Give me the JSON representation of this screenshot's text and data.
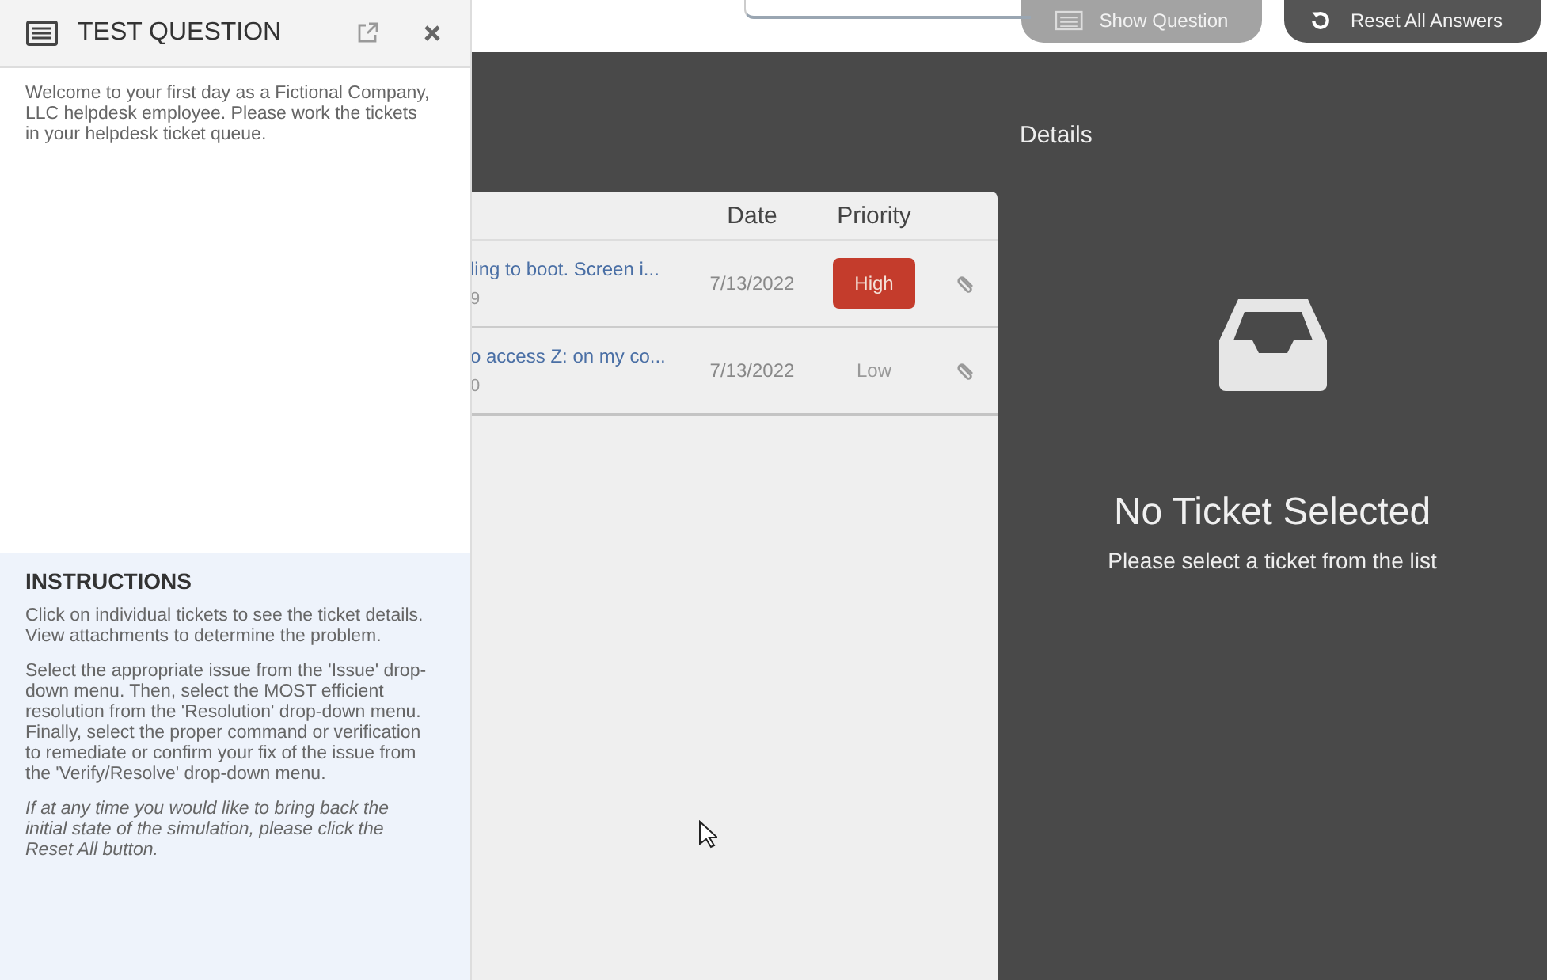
{
  "top_bar": {
    "buttons": [
      {
        "label": "Show Question",
        "kind": "secondary"
      },
      {
        "label": "Reset All Answers",
        "kind": "primary"
      }
    ]
  },
  "question_panel": {
    "title": "TEST QUESTION",
    "intro": "Welcome to your first day as a Fictional Company, LLC helpdesk employee. Please work the tickets in your helpdesk ticket queue.",
    "instructions_title": "INSTRUCTIONS",
    "instructions": [
      {
        "text": "Click on individual tickets to see the ticket details. View attachments to determine the problem.",
        "italic": false
      },
      {
        "text": "Select the appropriate issue from the 'Issue' drop-down menu. Then, select the MOST efficient resolution from the 'Resolution' drop-down menu. Finally, select the proper command or verification to remediate or confirm your fix of the issue from the 'Verify/Resolve' drop-down menu.",
        "italic": false
      },
      {
        "text": "If at any time you would like to bring back the initial state of the simulation, please click the Reset All button.",
        "italic": true
      }
    ]
  },
  "ticket_table": {
    "columns": [
      "Date",
      "Priority"
    ],
    "rows": [
      {
        "subject": "ling to boot. Screen i...",
        "sub": "9",
        "date": "7/13/2022",
        "priority": "High",
        "kind": "badge"
      },
      {
        "subject": "o access Z: on my co...",
        "sub": "0",
        "date": "7/13/2022",
        "priority": "Low",
        "kind": "plain"
      }
    ]
  },
  "details": {
    "title": "Details",
    "empty_title": "No Ticket Selected",
    "empty_text": "Please select a ticket from the list"
  }
}
